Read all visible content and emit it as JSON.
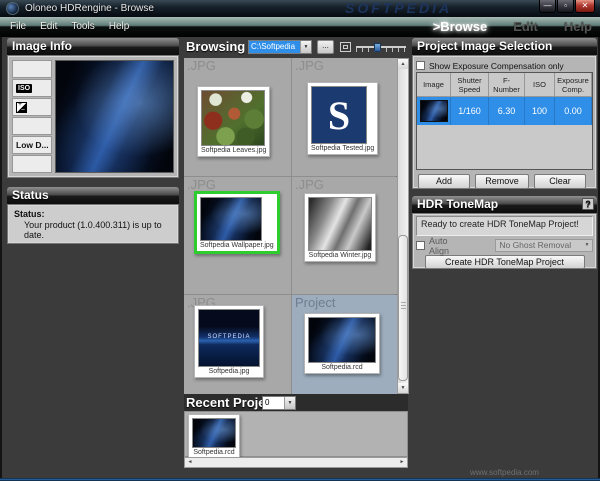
{
  "titlebar": {
    "title": "Oloneo HDRengine - Browse",
    "watermark": "SOFTPEDIA"
  },
  "window_controls": {
    "minimize": "—",
    "maximize": "▫",
    "close": "✕"
  },
  "menubar": {
    "items": [
      {
        "label": "File"
      },
      {
        "label": "Edit"
      },
      {
        "label": "Tools"
      },
      {
        "label": "Help"
      }
    ]
  },
  "mode_tabs": {
    "browse": ">Browse",
    "edit": "Edit",
    "help": "Help"
  },
  "image_info": {
    "title": "Image Info",
    "iso_label": "ISO",
    "expcomp_plus": "+",
    "expcomp_minus": "−",
    "low_d_label": "Low D..."
  },
  "status": {
    "title": "Status",
    "label": "Status:",
    "message": "Your product (1.0.400.311) is up to date."
  },
  "browsing": {
    "title": "Browsing",
    "path_value": "C:\\Softpedia",
    "browse_button_label": "...",
    "items": [
      {
        "type": ".JPG",
        "filename": "Softpedia Leaves.jpg",
        "selected": false
      },
      {
        "type": ".JPG",
        "filename": "Softpedia Tested.jpg",
        "selected": false,
        "overlay": "S"
      },
      {
        "type": ".JPG",
        "filename": "Softpedia Wallpaper.jpg",
        "selected": true
      },
      {
        "type": ".JPG",
        "filename": "Softpedia Winter.jpg",
        "selected": false
      },
      {
        "type": ".JPG",
        "filename": "Softpedia.jpg",
        "selected": false,
        "overlay": "SOFTPEDIA"
      },
      {
        "type": "Project",
        "filename": "Softpedia.rcd",
        "selected": false
      }
    ]
  },
  "recent_project": {
    "title": "Recent Project",
    "dropdown_value": "0",
    "items": [
      {
        "filename": "Softpedia.rcd"
      }
    ]
  },
  "project_selection": {
    "title": "Project Image Selection",
    "checkbox_label": "Show Exposure Compensation only",
    "table": {
      "headers": [
        "Image",
        "Shutter Speed",
        "F-Number",
        "ISO",
        "Exposure Comp."
      ],
      "rows": [
        {
          "shutter_speed": "1/160",
          "f_number": "6.30",
          "iso": "100",
          "exposure_comp": "0.00",
          "selected": true
        }
      ]
    },
    "buttons": {
      "add": "Add",
      "remove": "Remove",
      "clear": "Clear"
    }
  },
  "hdr_tonemap": {
    "title": "HDR ToneMap",
    "help_button": "?",
    "message": "Ready to create HDR ToneMap Project!",
    "auto_align_label": "Auto Align",
    "ghost_removal_value": "No Ghost Removal",
    "create_button": "Create HDR ToneMap Project",
    "watermark": "www.softpedia.com"
  },
  "icons": {
    "dropdown_arrow": "▼",
    "scroll_up": "▲",
    "scroll_down": "▼",
    "scroll_left": "◄",
    "scroll_right": "►"
  },
  "colors": {
    "selection_green": "#2ecc2e",
    "selection_blue": "#2f8fe8",
    "menubar_teal": "#5e7b75",
    "panel_gray": "#b5b5b5"
  }
}
